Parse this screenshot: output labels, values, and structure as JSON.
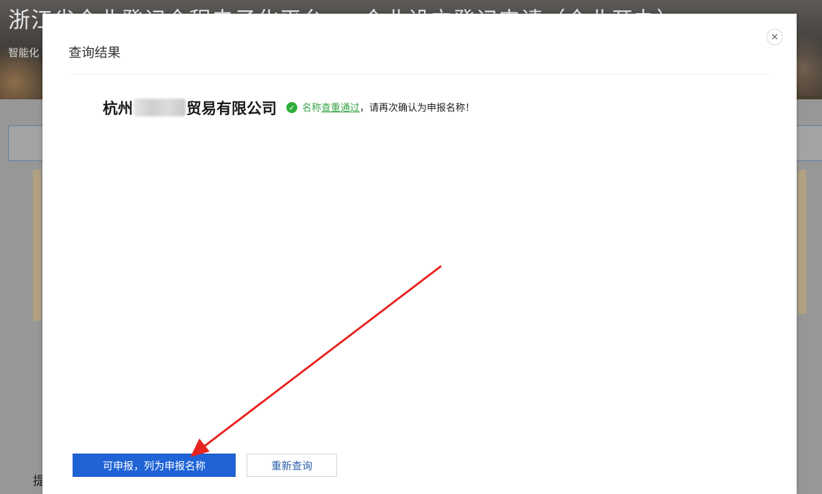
{
  "background": {
    "title": "浙江省企业登记全程电子化平台 — 企业设立登记申请（企业开办）",
    "subtitle": "智能化",
    "bottom_text": "提"
  },
  "modal": {
    "title": "查询结果",
    "close_symbol": "×",
    "result": {
      "name_prefix": "杭州",
      "name_suffix": "贸易有限公司",
      "status_part1": "名称",
      "status_link": "查重通过",
      "status_part2": "，请再次确认为申报名称！"
    },
    "buttons": {
      "primary": "可申报，列为申报名称",
      "secondary": "重新查询"
    }
  },
  "colors": {
    "accent": "#1f63d6",
    "success": "#2fae3c",
    "arrow": "#e8231f"
  }
}
